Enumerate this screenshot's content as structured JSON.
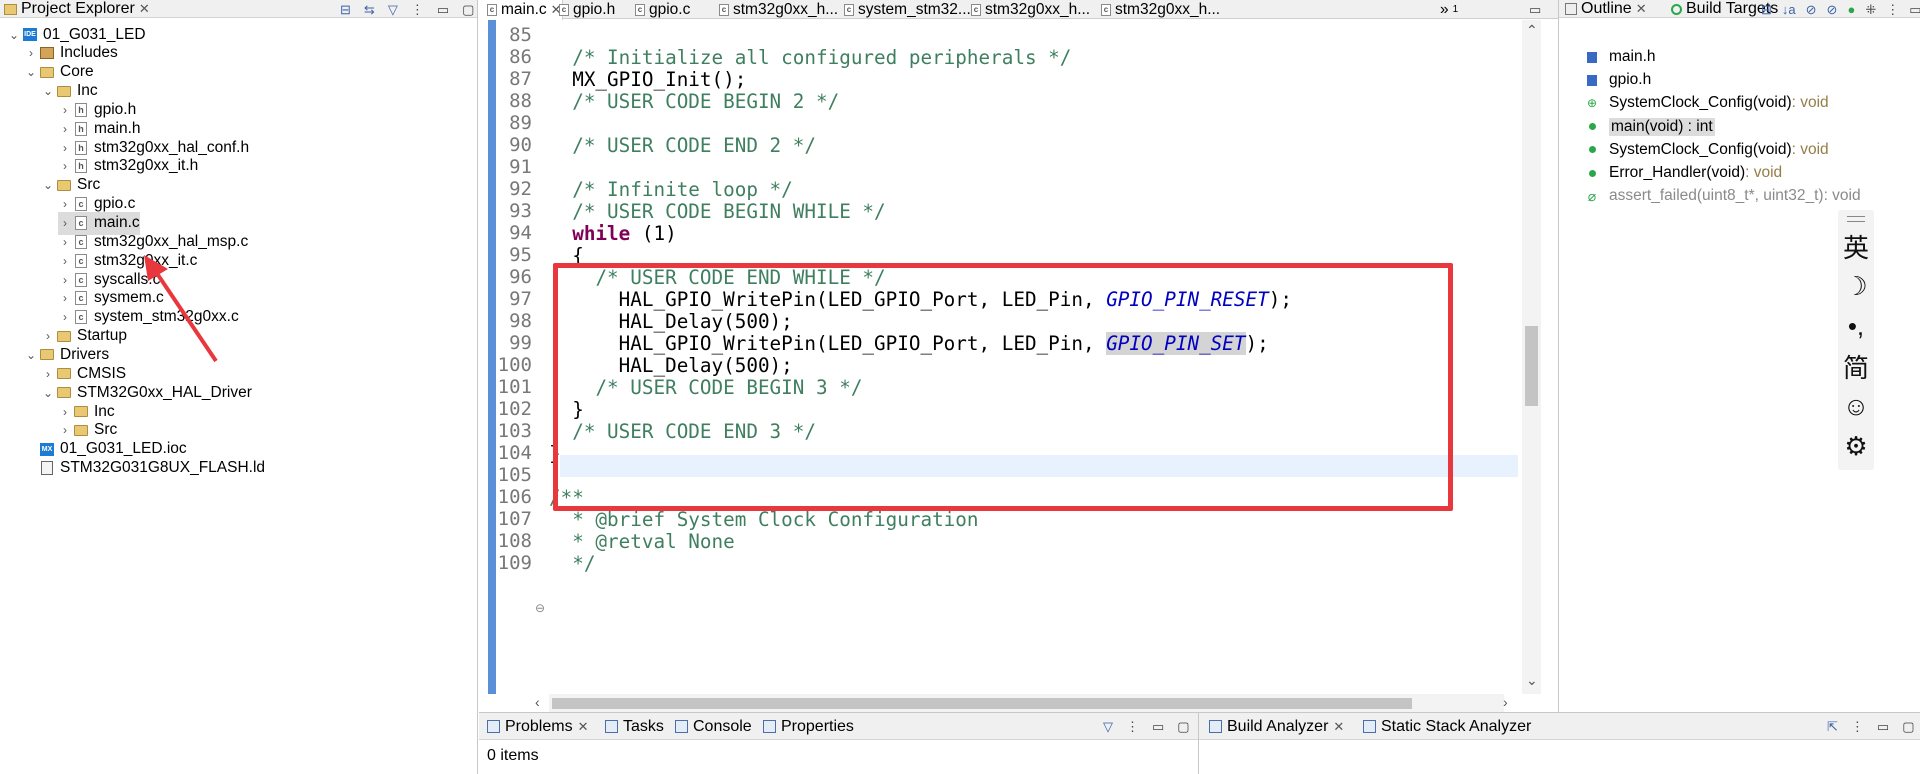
{
  "project_explorer": {
    "title": "Project Explorer",
    "close_glyph": "✕",
    "tree": [
      {
        "label": "01_G031_LED",
        "depth": 0,
        "kind": "project",
        "expanded": true
      },
      {
        "label": "Includes",
        "depth": 1,
        "kind": "includes",
        "expanded": false
      },
      {
        "label": "Core",
        "depth": 1,
        "kind": "folder",
        "expanded": true
      },
      {
        "label": "Inc",
        "depth": 2,
        "kind": "folder",
        "expanded": true
      },
      {
        "label": "gpio.h",
        "depth": 3,
        "kind": "h"
      },
      {
        "label": "main.h",
        "depth": 3,
        "kind": "h"
      },
      {
        "label": "stm32g0xx_hal_conf.h",
        "depth": 3,
        "kind": "h"
      },
      {
        "label": "stm32g0xx_it.h",
        "depth": 3,
        "kind": "h"
      },
      {
        "label": "Src",
        "depth": 2,
        "kind": "folder",
        "expanded": true
      },
      {
        "label": "gpio.c",
        "depth": 3,
        "kind": "c"
      },
      {
        "label": "main.c",
        "depth": 3,
        "kind": "c",
        "selected": true
      },
      {
        "label": "stm32g0xx_hal_msp.c",
        "depth": 3,
        "kind": "c"
      },
      {
        "label": "stm32g0xx_it.c",
        "depth": 3,
        "kind": "c"
      },
      {
        "label": "syscalls.c",
        "depth": 3,
        "kind": "c"
      },
      {
        "label": "sysmem.c",
        "depth": 3,
        "kind": "c"
      },
      {
        "label": "system_stm32g0xx.c",
        "depth": 3,
        "kind": "c"
      },
      {
        "label": "Startup",
        "depth": 2,
        "kind": "folder",
        "expanded": false
      },
      {
        "label": "Drivers",
        "depth": 1,
        "kind": "folder",
        "expanded": true
      },
      {
        "label": "CMSIS",
        "depth": 2,
        "kind": "folder",
        "expanded": false
      },
      {
        "label": "STM32G0xx_HAL_Driver",
        "depth": 2,
        "kind": "folder",
        "expanded": true
      },
      {
        "label": "Inc",
        "depth": 3,
        "kind": "folder",
        "expanded": false
      },
      {
        "label": "Src",
        "depth": 3,
        "kind": "folder",
        "expanded": false
      },
      {
        "label": "01_G031_LED.ioc",
        "depth": 1,
        "kind": "ioc"
      },
      {
        "label": "STM32G031G8UX_FLASH.ld",
        "depth": 1,
        "kind": "ld"
      }
    ]
  },
  "editor": {
    "tabs": [
      "main.c",
      "gpio.h",
      "gpio.c",
      "stm32g0xx_h...",
      "system_stm32...",
      "stm32g0xx_h...",
      "stm32g0xx_h..."
    ],
    "overflow_label": "»",
    "overflow_count": "1",
    "lines": [
      {
        "n": "85",
        "html": ""
      },
      {
        "n": "86",
        "html": "  <span class='cm'>/* Initialize all configured peripherals */</span>"
      },
      {
        "n": "87",
        "html": "  MX_GPIO_Init();"
      },
      {
        "n": "88",
        "html": "  <span class='cm'>/* USER CODE BEGIN 2 */</span>"
      },
      {
        "n": "89",
        "html": ""
      },
      {
        "n": "90",
        "html": "  <span class='cm'>/* USER CODE END 2 */</span>"
      },
      {
        "n": "91",
        "html": ""
      },
      {
        "n": "92",
        "html": "  <span class='cm'>/* Infinite loop */</span>"
      },
      {
        "n": "93",
        "html": "  <span class='cm'>/* USER CODE BEGIN WHILE */</span>"
      },
      {
        "n": "94",
        "html": "  <span class='kw'>while</span> (1)"
      },
      {
        "n": "95",
        "html": "  {"
      },
      {
        "n": "96",
        "html": "    <span class='cm'>/* USER CODE END WHILE */</span>"
      },
      {
        "n": "97",
        "html": "      HAL_GPIO_WritePin(LED_GPIO_Port, LED_Pin, <span class='mac'>GPIO_PIN_RESET</span>);"
      },
      {
        "n": "98",
        "html": "      HAL_Delay(500);"
      },
      {
        "n": "99",
        "html": "      HAL_GPIO_WritePin(LED_GPIO_Port, LED_Pin, <span class='mac occ'>GPIO_PIN_SET</span>);"
      },
      {
        "n": "100",
        "html": "      HAL_Delay(500);"
      },
      {
        "n": "101",
        "html": "    <span class='cm'>/* USER CODE BEGIN 3 */</span>"
      },
      {
        "n": "102",
        "html": "  }"
      },
      {
        "n": "103",
        "html": "  <span class='cm'>/* USER CODE END 3 */</span>"
      },
      {
        "n": "104",
        "html": "}"
      },
      {
        "n": "105",
        "html": ""
      },
      {
        "n": "106",
        "html": "<span class='cm'>/**</span>"
      },
      {
        "n": "107",
        "html": "  <span class='cm'>* @brief System Clock Configuration</span>"
      },
      {
        "n": "108",
        "html": "  <span class='cm'>* @retval None</span>"
      },
      {
        "n": "109",
        "html": "  <span class='cm'>*/</span>"
      }
    ],
    "fold_marker": "⊖"
  },
  "outline": {
    "tab_outline": "Outline",
    "tab_build_targets": "Build Targets",
    "items": [
      {
        "name": "main.h",
        "type": "",
        "icon": "header-include",
        "selected": false,
        "grayed": false
      },
      {
        "name": "gpio.h",
        "type": "",
        "icon": "header-include",
        "selected": false,
        "grayed": false
      },
      {
        "name": "SystemClock_Config(void)",
        "type": " : void",
        "icon": "declaration",
        "selected": false,
        "grayed": false
      },
      {
        "name": "main(void) : int",
        "type": "",
        "icon": "function",
        "selected": true,
        "grayed": false
      },
      {
        "name": "SystemClock_Config(void)",
        "type": " : void",
        "icon": "function",
        "selected": false,
        "grayed": false
      },
      {
        "name": "Error_Handler(void)",
        "type": " : void",
        "icon": "function",
        "selected": false,
        "grayed": false
      },
      {
        "name": "assert_failed(uint8_t*, uint32_t)",
        "type": " : void",
        "icon": "inactive-function",
        "selected": false,
        "grayed": true
      }
    ]
  },
  "ime_toolbar": {
    "items": [
      "英",
      "☽",
      "•,",
      "简",
      "☺",
      "⚙"
    ]
  },
  "bottom_left": {
    "tabs": [
      {
        "label": "Problems",
        "close": "✕"
      },
      {
        "label": "Tasks"
      },
      {
        "label": "Console"
      },
      {
        "label": "Properties"
      }
    ],
    "status": "0 items"
  },
  "bottom_right": {
    "tabs": [
      {
        "label": "Build Analyzer",
        "close": "✕"
      },
      {
        "label": "Static Stack Analyzer"
      }
    ]
  },
  "colors": {
    "comment": "#3f7f5f",
    "keyword": "#7f0055",
    "macro": "#0000c0",
    "highlight_box": "#e8383d",
    "ruler": "#5b8fd8"
  }
}
